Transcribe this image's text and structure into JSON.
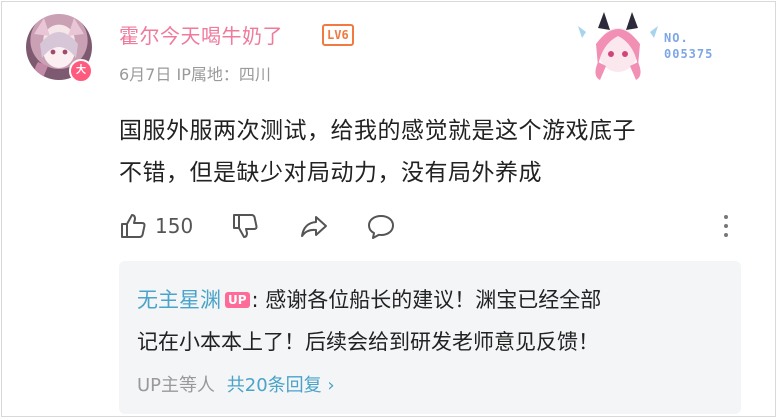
{
  "comment": {
    "username": "霍尔今天喝牛奶了",
    "level": "LV6",
    "avatar_badge": "大",
    "date": "6月7日",
    "ip_location": "IP属地：四川",
    "fan_number_label": "NO.",
    "fan_number": "005375",
    "text_line1": "国服外服两次测试，给我的感觉就是这个游戏底子",
    "text_line2": "不错，但是缺少对局动力，没有局外养成",
    "like_count": "150"
  },
  "reply": {
    "name": "无主星渊",
    "up_badge": "UP",
    "text_line1_rest": ": 感谢各位船长的建议！渊宝已经全部",
    "text_line2": "记在小本本上了！后续会给到研发老师意见反馈！",
    "footer_prefix": "UP主等人",
    "footer_link": "共20条回复",
    "footer_chevron": "›"
  },
  "colors": {
    "username": "#ef7a9c",
    "level": "#f07a40",
    "reply_name": "#4aa3c8",
    "up_badge": "#ff6b98"
  },
  "icons": [
    "like-icon",
    "dislike-icon",
    "share-icon",
    "comment-icon",
    "more-icon"
  ]
}
